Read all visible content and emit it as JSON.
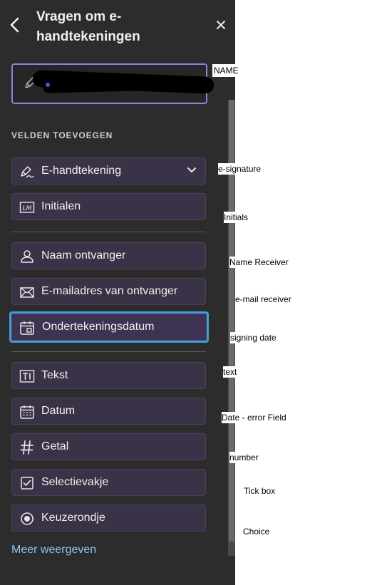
{
  "panel": {
    "title": "Vragen om e-handtekeningen",
    "section_label": "VELDEN TOEVOEGEN",
    "more_link": "Meer weergeven"
  },
  "fields": [
    {
      "label": "E-handtekening",
      "icon": "signature-pen-icon",
      "has_dropdown": true
    },
    {
      "label": "Initialen",
      "icon": "initials-lm-icon"
    },
    {
      "label": "Naam ontvanger",
      "icon": "person-icon"
    },
    {
      "label": "E-mailadres van ontvanger",
      "icon": "envelope-icon"
    },
    {
      "label": "Ondertekeningsdatum",
      "icon": "calendar-sign-icon",
      "selected": true
    },
    {
      "label": "Tekst",
      "icon": "text-field-icon"
    },
    {
      "label": "Datum",
      "icon": "calendar-icon"
    },
    {
      "label": "Getal",
      "icon": "hash-icon"
    },
    {
      "label": "Selectievakje",
      "icon": "checkbox-icon"
    },
    {
      "label": "Keuzerondje",
      "icon": "radio-icon"
    }
  ],
  "annotations": {
    "name": "NAME",
    "esig": "e-signature",
    "initials": "Initials",
    "name_receiver": "Name Receiver",
    "email_receiver": "e-mail receiver",
    "signing_date": "signing date",
    "text": "text",
    "date": "Date - error Field",
    "number": "number",
    "tick": "Tick box",
    "choice": "Choice"
  },
  "colors": {
    "panel_bg": "#2c2c2c",
    "field_bg": "#3a3247",
    "selected_border": "#3e9bd9",
    "signer_border": "#9a7ce0",
    "link": "#8ec4ef"
  }
}
